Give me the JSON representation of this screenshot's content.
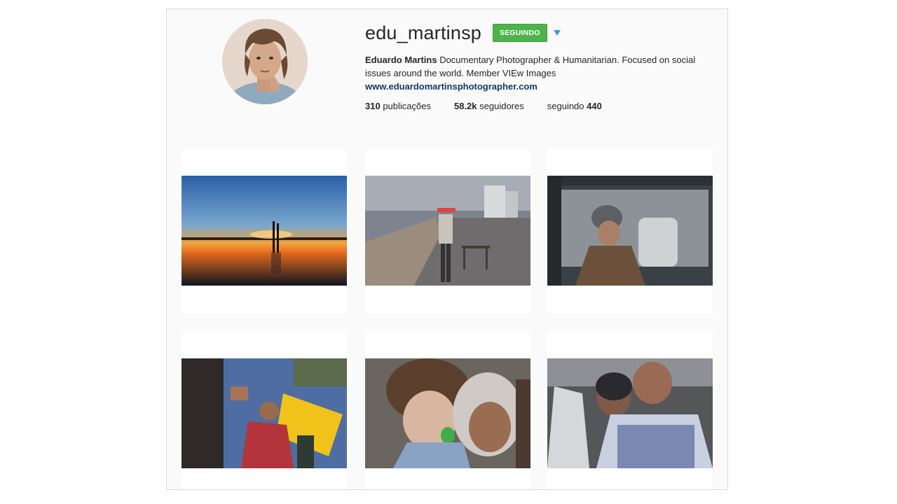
{
  "profile": {
    "username": "edu_martinsp",
    "follow_label": "SEGUINDO",
    "full_name": "Eduardo Martins",
    "bio_text": " Documentary Photographer & Humanitarian. Focused on social issues around the world. Member VIEw Images",
    "website": "www.eduardomartinsphotographer.com"
  },
  "stats": {
    "posts_count": "310",
    "posts_label": " publicações",
    "followers_count": "58.2k",
    "followers_label": " seguidores",
    "following_label": "seguindo ",
    "following_count": "440"
  },
  "icons": {
    "dropdown": "triangle-down-icon"
  },
  "colors": {
    "follow_button": "#4fb34b",
    "link": "#12386e",
    "dropdown": "#3897f0"
  }
}
